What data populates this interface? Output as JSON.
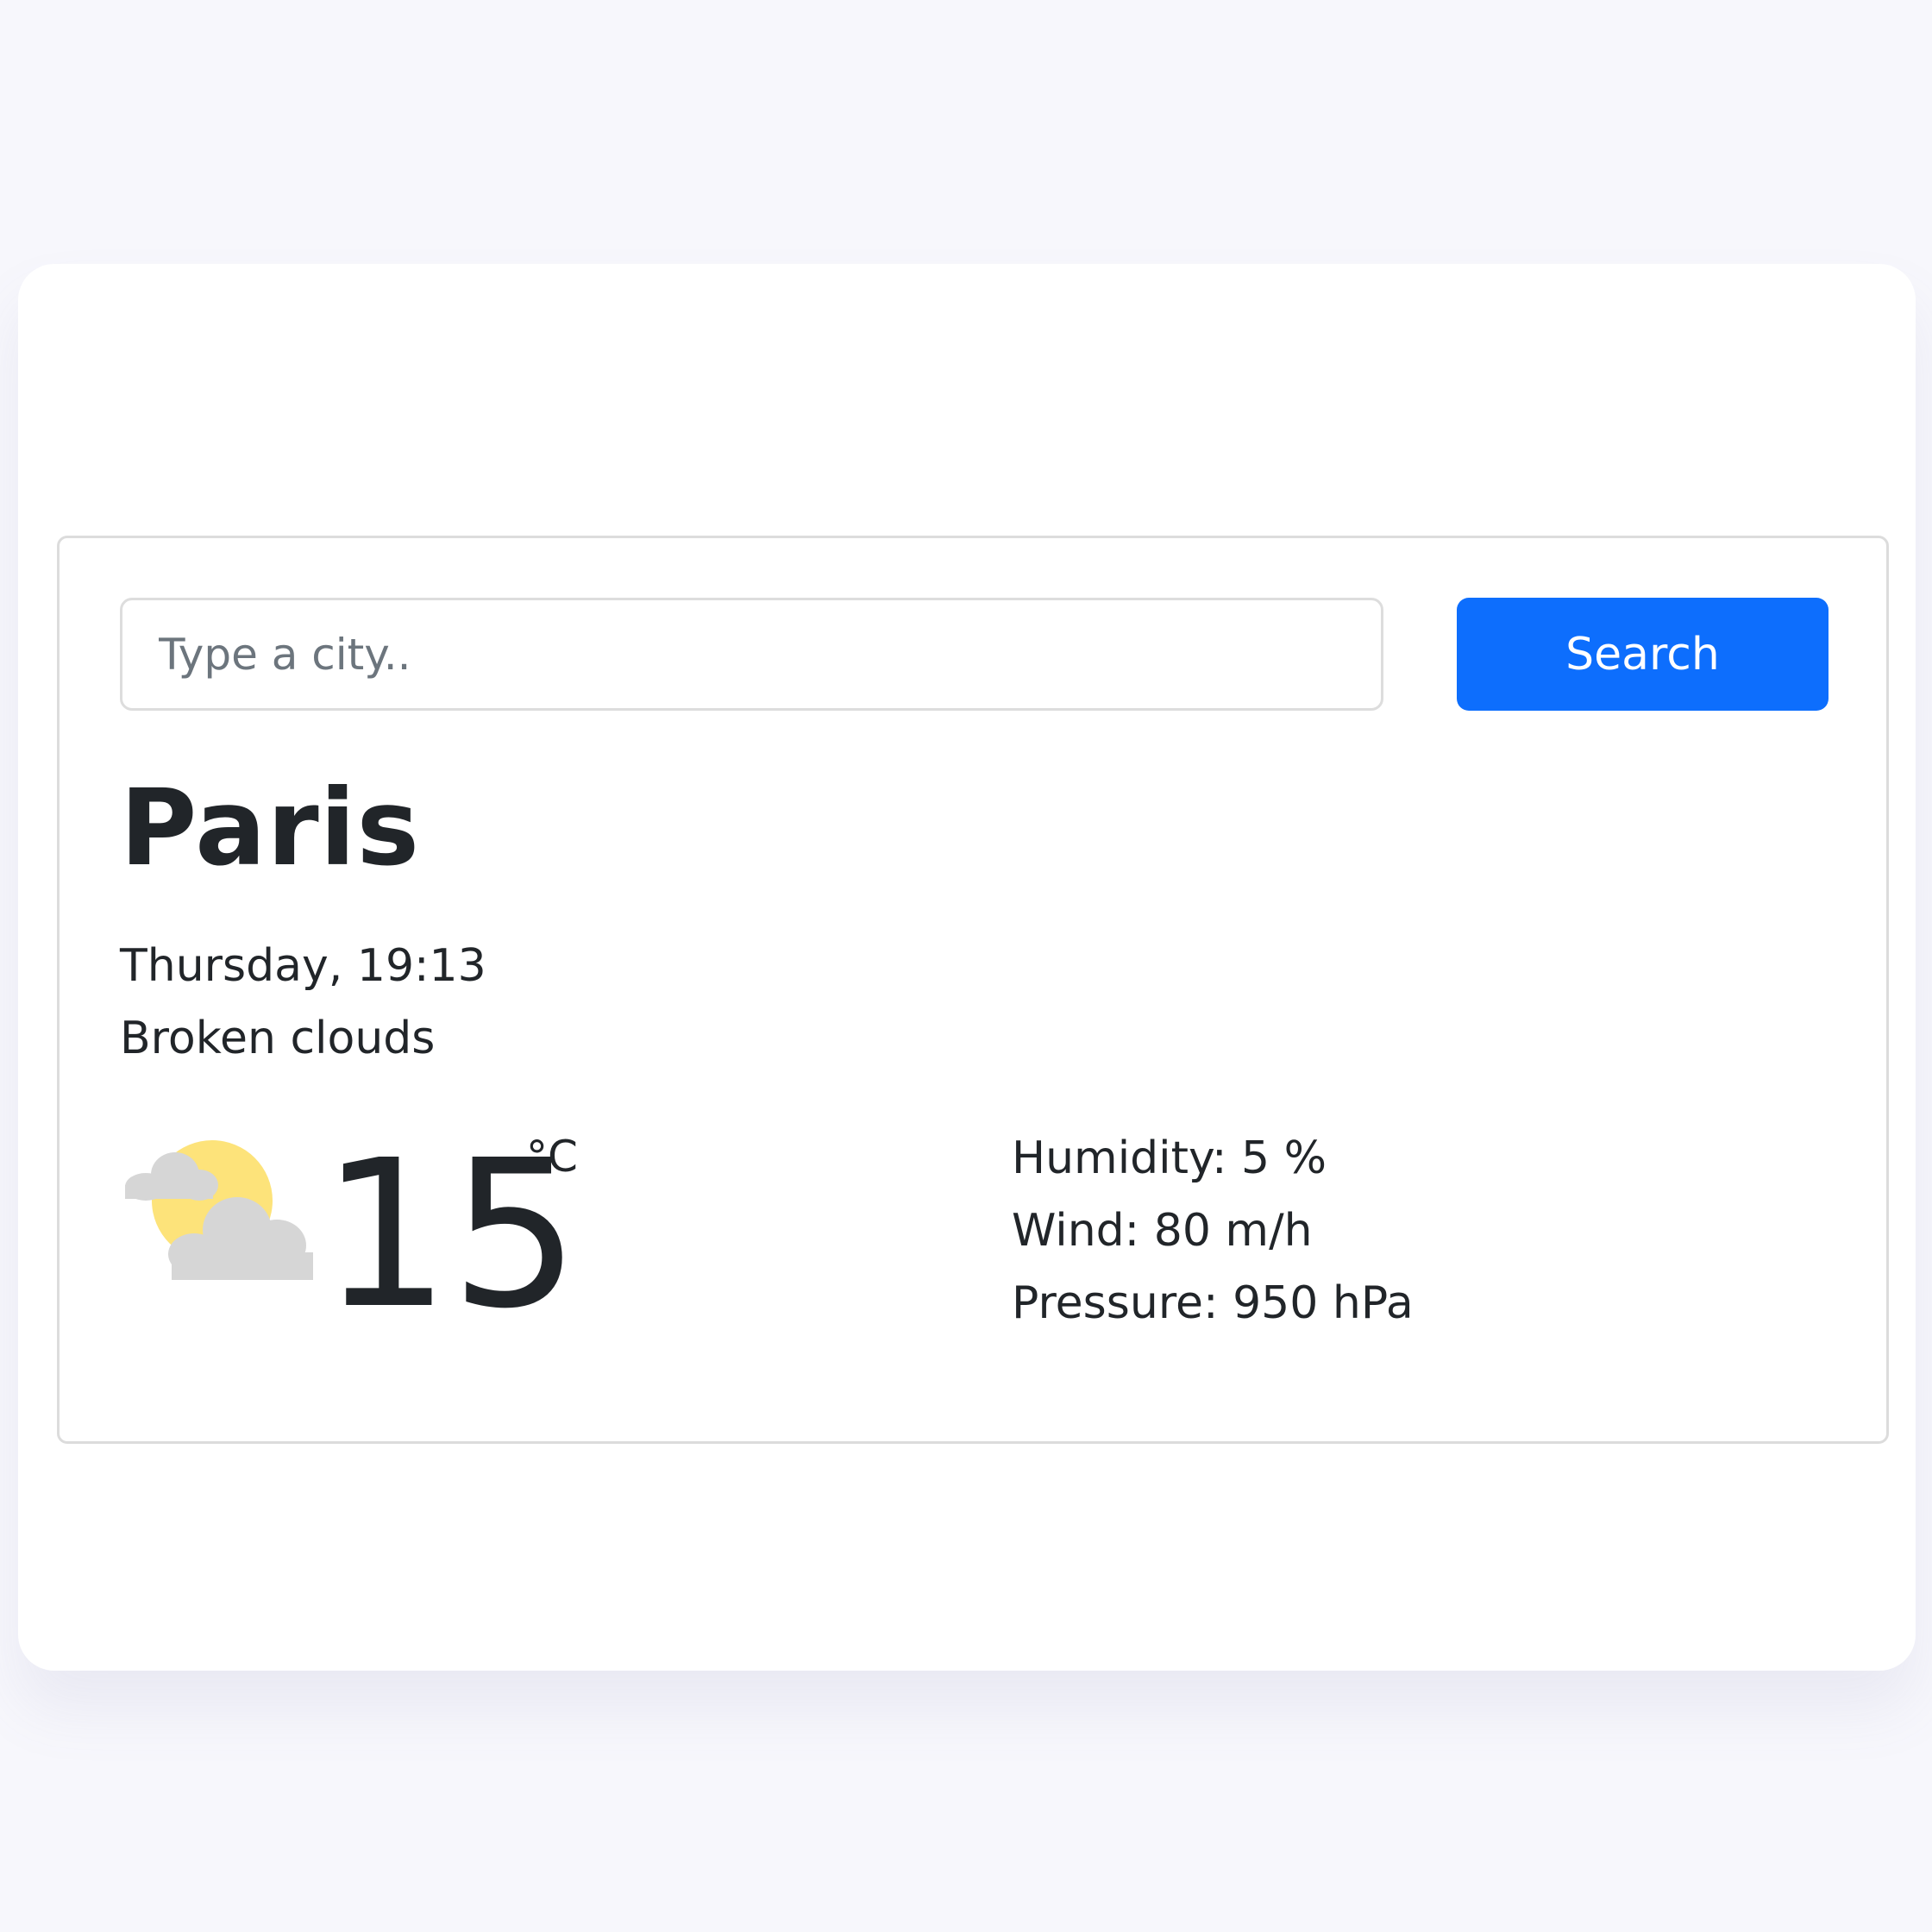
{
  "search": {
    "placeholder": "Type a city..",
    "value": "",
    "button_label": "Search",
    "button_color": "#0d6efd"
  },
  "city": "Paris",
  "date_time": "Thursday, 19:13",
  "description": "Broken clouds",
  "weather_icon": "partly-cloudy-icon",
  "temperature": {
    "value": "15",
    "unit": "°C"
  },
  "stats": {
    "humidity": "Humidity: 5 %",
    "wind": "Wind: 80 m/h",
    "pressure": "Pressure: 950 hPa"
  },
  "colors": {
    "page_background": "#f7f7fc",
    "card_background": "#ffffff",
    "text": "#212529",
    "sun": "#fde37a",
    "cloud": "#d6d6d6"
  }
}
